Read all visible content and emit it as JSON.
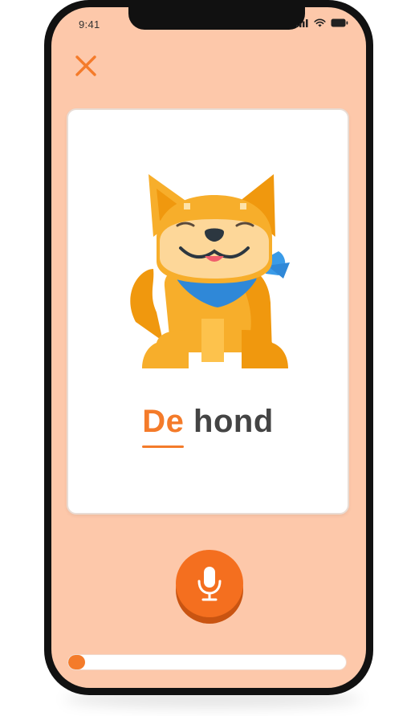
{
  "status_bar": {
    "time": "9:41",
    "icons": [
      "signal-icon",
      "wifi-icon",
      "battery-icon"
    ]
  },
  "toolbar": {
    "close_icon": "close-icon"
  },
  "flashcard": {
    "image": "dog-illustration",
    "article": "De",
    "noun": "hond"
  },
  "microphone": {
    "icon": "microphone-icon"
  },
  "progress": {
    "fraction": 0.06
  },
  "colors": {
    "background": "#fdc8aa",
    "accent": "#f47b2a",
    "text": "#444444"
  }
}
